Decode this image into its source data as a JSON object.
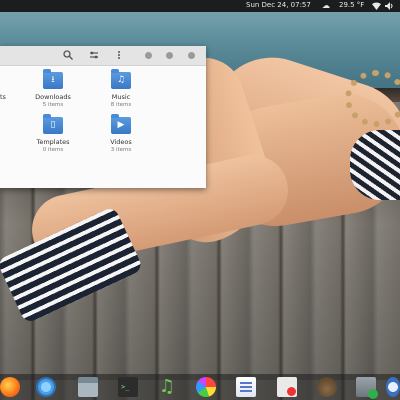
{
  "top_panel": {
    "clock": "Sun Dec 24, 07:57",
    "weather_icon": "cloud-icon",
    "weather": "29.5 °F"
  },
  "window": {
    "toolbar_icons": [
      "search-icon",
      "sort-icon",
      "menu-dots-icon"
    ],
    "clipped_label": "ts",
    "items": [
      {
        "name": "Downloads",
        "count": "5 items",
        "icon": "download-arrow"
      },
      {
        "name": "Music",
        "count": "8 items",
        "icon": "music-note"
      },
      {
        "name": "Templates",
        "count": "0 items",
        "icon": "document"
      },
      {
        "name": "Videos",
        "count": "3 items",
        "icon": "video-camera"
      }
    ]
  },
  "dock": {
    "apps": [
      "firefox",
      "chromium",
      "files",
      "terminal",
      "music",
      "photos",
      "documents",
      "screenshot",
      "gimp",
      "calculator",
      "web-browser"
    ]
  }
}
